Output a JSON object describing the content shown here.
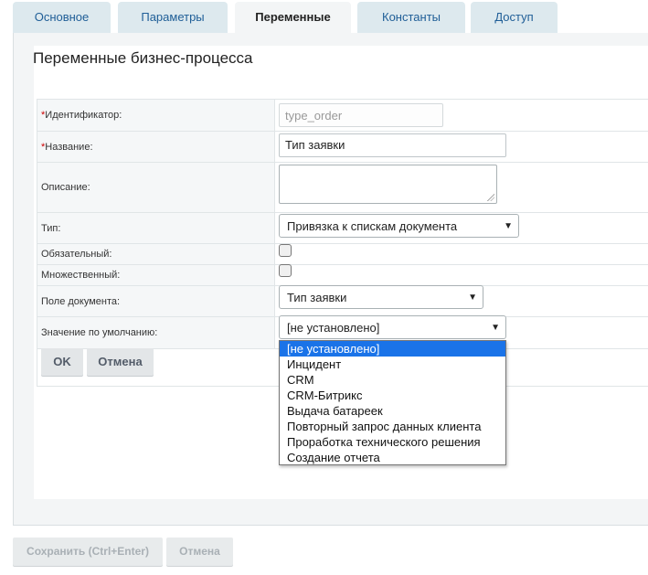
{
  "tabs": [
    {
      "label": "Основное"
    },
    {
      "label": "Параметры"
    },
    {
      "label": "Переменные"
    },
    {
      "label": "Константы"
    },
    {
      "label": "Доступ"
    }
  ],
  "active_tab": "Переменные",
  "page_title": "Переменные бизнес-процесса",
  "form": {
    "identifier": {
      "label": "Идентификатор:",
      "required": "*",
      "placeholder": "type_order"
    },
    "name": {
      "label": "Название:",
      "required": "*",
      "value": "Тип заявки"
    },
    "description": {
      "label": "Описание:",
      "value": ""
    },
    "type": {
      "label": "Тип:",
      "value": "Привязка к спискам документа"
    },
    "mandatory": {
      "label": "Обязательный:",
      "checked": false
    },
    "multiple": {
      "label": "Множественный:",
      "checked": false
    },
    "document_field": {
      "label": "Поле документа:",
      "value": "Тип заявки"
    },
    "default_value": {
      "label": "Значение по умолчанию:",
      "value": "[не установлено]"
    }
  },
  "buttons": {
    "ok": "OK",
    "cancel": "Отмена"
  },
  "dropdown_options": [
    "[не установлено]",
    "Инцидент",
    "CRM",
    "CRM-Битрикс",
    "Выдача батареек",
    "Повторный запрос данных клиента",
    "Проработка технического решения",
    "Создание отчета"
  ],
  "selected_option_index": 0,
  "footer": {
    "save": "Сохранить (Ctrl+Enter)",
    "cancel": "Отмена"
  },
  "colors": {
    "tab_link": "#1f5e97",
    "required": "#cc0000",
    "selected_option": "#1a73e8"
  }
}
